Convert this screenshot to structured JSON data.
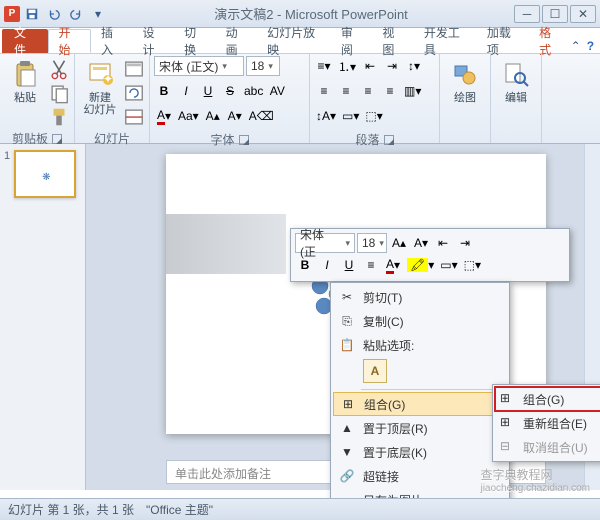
{
  "title": "演示文稿2 - Microsoft PowerPoint",
  "app_badge": "P",
  "tabs": {
    "file": "文件",
    "home": "开始",
    "insert": "插入",
    "design": "设计",
    "transition": "切换",
    "animation": "动画",
    "slideshow": "幻灯片放映",
    "review": "审阅",
    "view": "视图",
    "developer": "开发工具",
    "addins": "加载项",
    "format": "格式"
  },
  "groups": {
    "clipboard": {
      "label": "剪贴板",
      "paste": "粘贴"
    },
    "slides": {
      "label": "幻灯片",
      "new_slide": "新建\n幻灯片"
    },
    "font": {
      "label": "字体",
      "name": "宋体 (正文)",
      "size": "18"
    },
    "paragraph": {
      "label": "段落"
    },
    "drawing": {
      "label": "绘图",
      "btn": "绘图"
    },
    "editing": {
      "label": "编辑",
      "btn": "编辑"
    }
  },
  "thumb": {
    "num": "1"
  },
  "notes_placeholder": "单击此处添加备注",
  "minitool": {
    "font": "宋体 (正",
    "size": "18"
  },
  "ctx": {
    "cut": "剪切(T)",
    "copy": "复制(C)",
    "paste_label": "粘贴选项:",
    "paste_opt": "A",
    "group": "组合(G)",
    "bring_front": "置于顶层(R)",
    "send_back": "置于底层(K)",
    "hyperlink": "超链接",
    "save_as_pic": "另存为图片"
  },
  "submenu": {
    "group": "组合(G)",
    "regroup": "重新组合(E)",
    "ungroup": "取消组合(U)"
  },
  "status": {
    "slide": "幻灯片 第 1 张，共 1 张",
    "theme": "\"Office 主题\""
  },
  "watermark": "查字典教程网",
  "watermark_url": "jiaocheng.chazidian.com"
}
